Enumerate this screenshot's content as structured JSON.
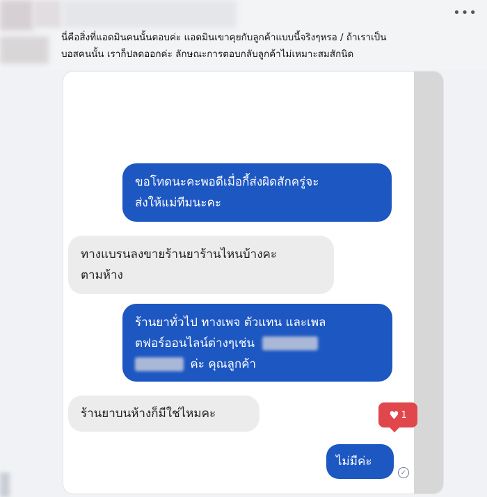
{
  "post": {
    "more_icon": "more-horizontal-icon",
    "caption_line1": "นี่คือสิ่งที่แอดมินคนนั้นตอบค่ะ แอดมินเขาคุยกับลูกค้าแบบนี้จริงๆหรอ     / ถ้าเราเป็น",
    "caption_line2": "บอสคนนั้น เราก็ปลดออกค่ะ  ลักษณะการตอบกลับลูกค้าไม่เหมาะสมสักนิด"
  },
  "chat": {
    "messages": [
      {
        "side": "out",
        "line1": "ขอโทดนะคะพอดีเมื่อกี้ส่งผิดสักครู่จะ",
        "line2": "ส่งให้แม่ทีมนะคะ"
      },
      {
        "side": "in",
        "line1": "ทางแบรนลงขายร้านยาร้านไหนบ้างคะ",
        "line2": "ตามห้าง"
      },
      {
        "side": "out",
        "line1": "ร้านยาทั่วไป ทางเพจ ตัวแทน และเพล",
        "line2": "ตฟอร์ออนไลน์ต่างๆเช่น",
        "line3": "ค่ะ  คุณลูกค้า"
      },
      {
        "side": "in",
        "line1": "ร้านยาบนห้างก็มีใช่ไหมคะ"
      },
      {
        "side": "out",
        "line1": "ไม่มีค่ะ"
      }
    ],
    "reaction": {
      "icon": "heart-icon",
      "count": "1"
    },
    "seen_icon": "seen-check-icon",
    "colors": {
      "outgoing": "#1d57c2",
      "incoming": "#ececec",
      "reaction": "#e0474c"
    }
  }
}
